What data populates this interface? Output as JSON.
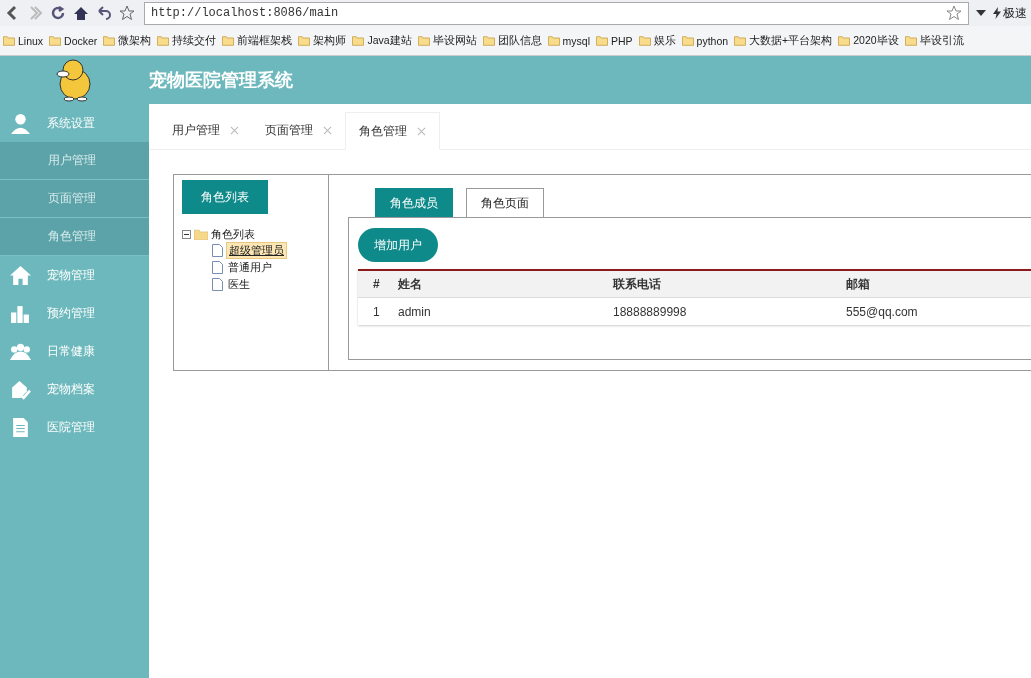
{
  "browser": {
    "url": "http://localhost:8086/main",
    "search_label": "极速",
    "bookmarks": [
      "Linux",
      "Docker",
      "微架构",
      "持续交付",
      "前端框架栈",
      "架构师",
      "Java建站",
      "毕设网站",
      "团队信息",
      "mysql",
      "PHP",
      "娱乐",
      "python",
      "大数据+平台架构",
      "2020毕设",
      "毕设引流"
    ]
  },
  "app": {
    "title": "宠物医院管理系统"
  },
  "sidebar": {
    "items": [
      {
        "label": "系统设置",
        "children": [
          {
            "label": "用户管理",
            "selected": false
          },
          {
            "label": "页面管理",
            "selected": false
          },
          {
            "label": "角色管理",
            "selected": false
          }
        ]
      },
      {
        "label": "宠物管理"
      },
      {
        "label": "预约管理"
      },
      {
        "label": "日常健康"
      },
      {
        "label": "宠物档案"
      },
      {
        "label": "医院管理"
      }
    ]
  },
  "tabs": [
    {
      "label": "用户管理",
      "selected": false
    },
    {
      "label": "页面管理",
      "selected": false
    },
    {
      "label": "角色管理",
      "selected": true
    }
  ],
  "role_panel": {
    "button": "角色列表",
    "tree": {
      "label": "角色列表",
      "expanded": true,
      "children": [
        {
          "label": "超级管理员",
          "selected": true
        },
        {
          "label": "普通用户",
          "selected": false
        },
        {
          "label": "医生",
          "selected": false
        }
      ]
    }
  },
  "sub_tabs": [
    {
      "label": "角色成员",
      "selected": true
    },
    {
      "label": "角色页面",
      "selected": false
    }
  ],
  "add_button": "增加用户",
  "table": {
    "columns": [
      "#",
      "姓名",
      "联系电话",
      "邮箱"
    ],
    "rows": [
      [
        "1",
        "admin",
        "18888889998",
        "555@qq.com"
      ]
    ]
  }
}
